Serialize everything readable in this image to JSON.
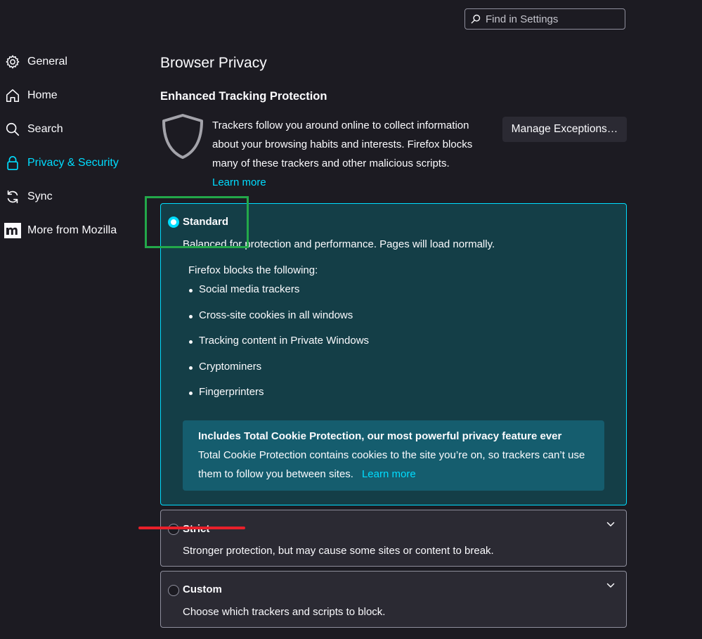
{
  "search": {
    "placeholder": "Find in Settings"
  },
  "sidebar": {
    "items": [
      {
        "label": "General",
        "icon": "gear-icon"
      },
      {
        "label": "Home",
        "icon": "home-icon"
      },
      {
        "label": "Search",
        "icon": "search-icon"
      },
      {
        "label": "Privacy & Security",
        "icon": "lock-icon",
        "active": true
      },
      {
        "label": "Sync",
        "icon": "sync-icon"
      },
      {
        "label": "More from Mozilla",
        "icon": "mozilla-m-icon"
      }
    ]
  },
  "page": {
    "title": "Browser Privacy",
    "etp": {
      "heading": "Enhanced Tracking Protection",
      "description": "Trackers follow you around online to collect information about your browsing habits and interests. Firefox blocks many of these trackers and other malicious scripts.",
      "learn_more": "Learn more",
      "exceptions_button": "Manage Exceptions…"
    },
    "standard": {
      "title": "Standard",
      "description": "Balanced for protection and performance. Pages will load normally.",
      "blocks_heading": "Firefox blocks the following:",
      "blocks": [
        "Social media trackers",
        "Cross-site cookies in all windows",
        "Tracking content in Private Windows",
        "Cryptominers",
        "Fingerprinters"
      ],
      "tcp_title": "Includes Total Cookie Protection, our most powerful privacy feature ever",
      "tcp_body": "Total Cookie Protection contains cookies to the site you’re on, so trackers can’t use them to follow you between sites.",
      "tcp_link": "Learn more",
      "selected": true
    },
    "strict": {
      "title": "Strict",
      "description": "Stronger protection, but may cause some sites or content to break.",
      "selected": false
    },
    "custom": {
      "title": "Custom",
      "description": "Choose which trackers and scripts to block.",
      "selected": false
    }
  },
  "colors": {
    "background": "#1c1b22",
    "accent": "#00ddff",
    "selected_card": "#143e47",
    "tcp_banner": "#155d6e",
    "annotation_green": "#23a84a",
    "annotation_red": "#e8202a"
  }
}
